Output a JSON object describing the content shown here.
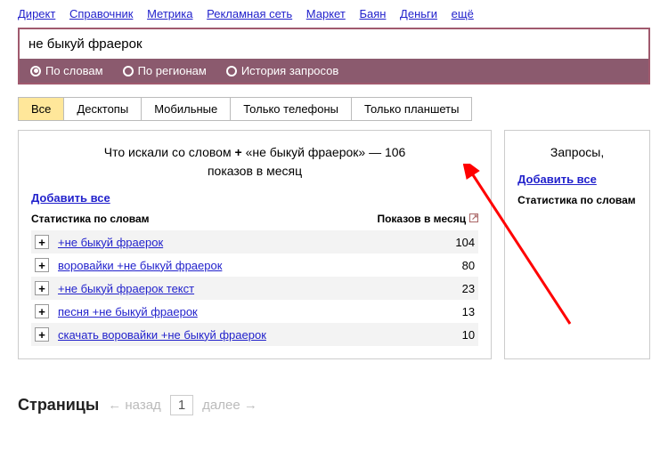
{
  "topLinks": [
    "Директ",
    "Справочник",
    "Метрика",
    "Рекламная сеть",
    "Маркет",
    "Баян",
    "Деньги",
    "ещё"
  ],
  "search": {
    "value": "не быкуй фраерок"
  },
  "filter": {
    "options": [
      "По словам",
      "По регионам",
      "История запросов"
    ],
    "selected": 0
  },
  "tabs": [
    "Все",
    "Десктопы",
    "Мобильные",
    "Только телефоны",
    "Только планшеты"
  ],
  "activeTab": 0,
  "left": {
    "titlePrefix": "Что искали со словом",
    "titlePlus": "+",
    "titleQuery": "«не быкуй фраерок»",
    "titleDash": "—",
    "titleCount": "106",
    "titleSuffix": "показов в месяц",
    "addAll": "Добавить все",
    "statsHeader": "Статистика по словам",
    "countHeader": "Показов в месяц",
    "rows": [
      {
        "kw": "+не быкуй фраерок",
        "count": "104"
      },
      {
        "kw": "воровайки +не быкуй фраерок",
        "count": "80"
      },
      {
        "kw": "+не быкуй фраерок текст",
        "count": "23"
      },
      {
        "kw": "песня +не быкуй фраерок",
        "count": "13"
      },
      {
        "kw": "скачать воровайки +не быкуй фраерок",
        "count": "10"
      }
    ]
  },
  "right": {
    "title": "Запросы,",
    "addAll": "Добавить все",
    "statsHeader": "Статистика по словам"
  },
  "pagination": {
    "label": "Страницы",
    "prev": "← назад",
    "page": "1",
    "next": "далее →"
  }
}
